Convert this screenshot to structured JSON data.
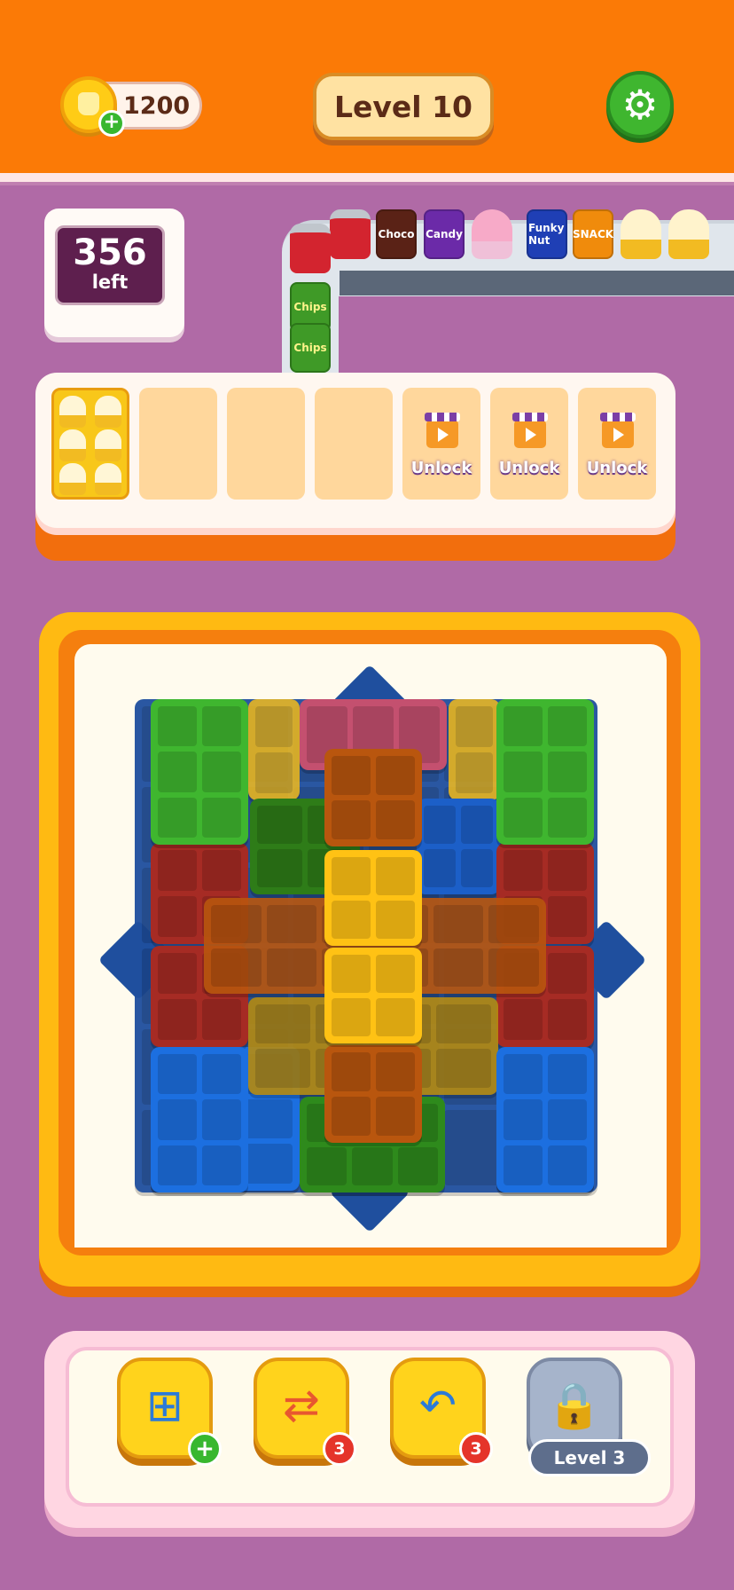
{
  "header": {
    "coins": "1200",
    "level_label": "Level 10"
  },
  "counter": {
    "count": "356",
    "label": "left"
  },
  "conveyor": {
    "items": [
      {
        "kind": "can",
        "label": ""
      },
      {
        "kind": "bag",
        "label": "Choco",
        "color": "#5a2216"
      },
      {
        "kind": "bag",
        "label": "Candy",
        "color": "#6b2aa8"
      },
      {
        "kind": "cone",
        "label": ""
      },
      {
        "kind": "bag",
        "label": "Funky Nut",
        "color": "#1f3fb5"
      },
      {
        "kind": "bag",
        "label": "SNACK",
        "color": "#f08b0c"
      },
      {
        "kind": "cup",
        "label": ""
      },
      {
        "kind": "cup",
        "label": ""
      }
    ],
    "down_items": [
      {
        "kind": "can",
        "label": ""
      },
      {
        "kind": "chips",
        "label": "Chips"
      },
      {
        "kind": "chips",
        "label": "Chips"
      }
    ]
  },
  "slots": {
    "unlock_label": "Unlock",
    "filled_icon": "cupcake-tray",
    "locked_icon": "clapperboard-icon"
  },
  "toolbar": {
    "add_slot_icon": "add-slot-icon",
    "shuffle_icon": "shuffle-icon",
    "shuffle_count": "3",
    "undo_icon": "undo-icon",
    "undo_count": "3",
    "locked_icon": "padlock-icon",
    "locked_label": "Level 3"
  },
  "colors": {
    "header_orange": "#fb7a06",
    "background_purple": "#b06aa6",
    "green": "#3fb62f",
    "yellow": "#ffc214",
    "brown": "#b9560e",
    "red": "#a62b24",
    "blue": "#1c6fe0",
    "pink": "#c4506f"
  }
}
